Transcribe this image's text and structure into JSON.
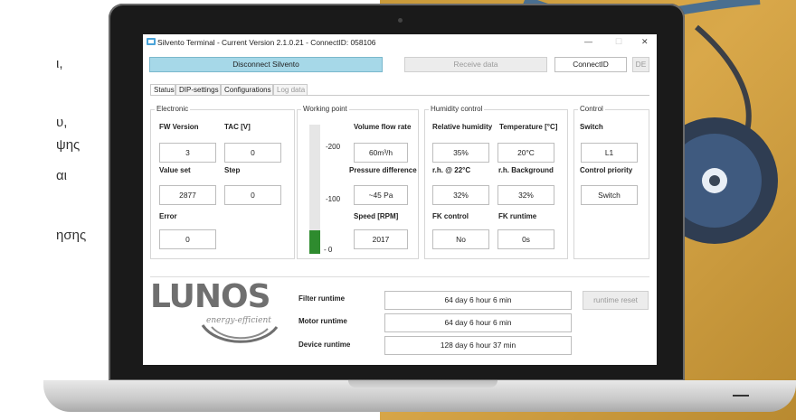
{
  "left_text": [
    "ι,",
    "υ,",
    "ψης",
    "αι",
    "ησης"
  ],
  "window": {
    "title": "Silvento Terminal  - Current Version 2.1.0.21  - ConnectID: 058106",
    "minimize": "—",
    "maximize": "☐",
    "close": "✕"
  },
  "toolbar": {
    "disconnect_label": "Disconnect Silvento",
    "receive_label": "Receive data",
    "connect_id_value": "ConnectID",
    "language_label": "DE"
  },
  "tabs": [
    "Status",
    "DIP-settings",
    "Configurations",
    "Log data"
  ],
  "electronic": {
    "title": "Electronic",
    "fw_version_label": "FW Version",
    "fw_version_value": "3",
    "tac_label": "TAC [V]",
    "tac_value": "0",
    "value_set_label": "Value set",
    "value_set_value": "2877",
    "step_label": "Step",
    "step_value": "0",
    "error_label": "Error",
    "error_value": "0"
  },
  "working_point": {
    "title": "Working point",
    "tick_top": "-200",
    "tick_mid": "-100",
    "tick_bottom": "- 0",
    "gauge_level": 0.18,
    "gauge_color": "#2e8b2e",
    "volume_flow_label": "Volume flow rate",
    "volume_flow_value": "60m³/h",
    "pressure_label": "Pressure difference",
    "pressure_value": "~45 Pa",
    "speed_label": "Speed [RPM]",
    "speed_value": "2017"
  },
  "humidity": {
    "title": "Humidity control",
    "rel_humidity_label": "Relative humidity",
    "rel_humidity_value": "35%",
    "temperature_label": "Temperature [°C]",
    "temperature_value": "20°C",
    "rh22_label": "r.h. @ 22°C",
    "rh22_value": "32%",
    "rh_bg_label": "r.h. Background",
    "rh_bg_value": "32%",
    "fk_control_label": "FK control",
    "fk_control_value": "No",
    "fk_runtime_label": "FK runtime",
    "fk_runtime_value": "0s"
  },
  "control": {
    "title": "Control",
    "switch_label": "Switch",
    "switch_value": "L1",
    "priority_label": "Control priority",
    "priority_value": "Switch"
  },
  "logo": {
    "name": "LUNOS",
    "tagline": "energy-efficient"
  },
  "runtime": {
    "filter_label": "Filter runtime",
    "filter_value": "64 day 6 hour 6 min",
    "motor_label": "Motor runtime",
    "motor_value": "64 day 6 hour 6 min",
    "device_label": "Device runtime",
    "device_value": "128 day 6 hour 37 min",
    "reset_label": "runtime reset"
  },
  "colors": {
    "accent_blue": "#a6d8e8",
    "gold_background": "#d9a84a",
    "gauge_green": "#2e8b2e"
  }
}
